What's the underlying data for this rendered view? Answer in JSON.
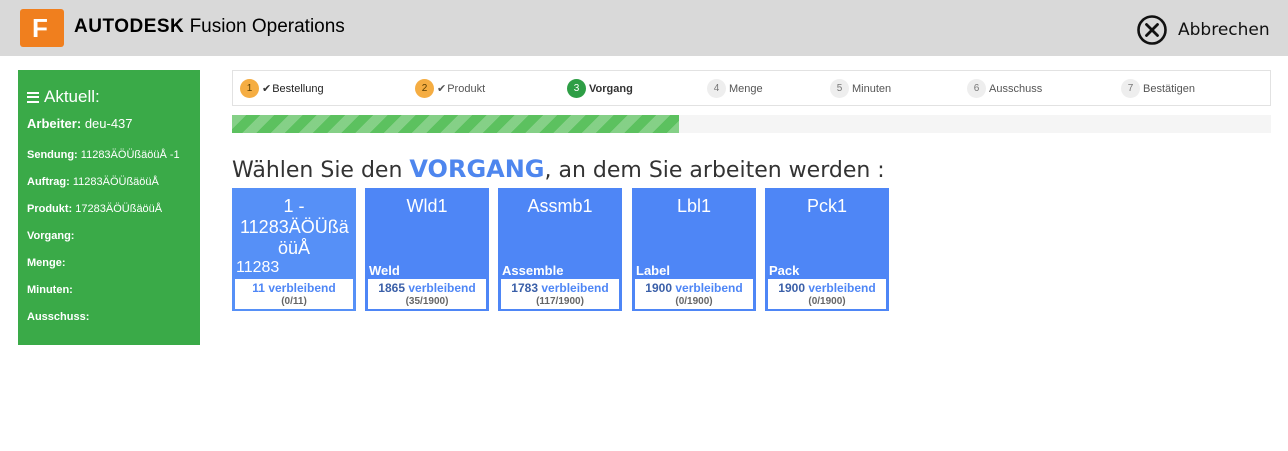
{
  "header": {
    "logo_letter": "F",
    "brand_bold": "AUTODESK",
    "brand_rest": "Fusion Operations",
    "cancel_label": "Abbrechen",
    "accent_color": "#f26f21"
  },
  "sidebar": {
    "title": "Aktuell:",
    "worker_label": "Arbeiter:",
    "worker_value": "deu-437",
    "rows": [
      {
        "label": "Sendung:",
        "value": "11283ÄÖÜßäöüÅ -1"
      },
      {
        "label": "Auftrag:",
        "value": "11283ÄÖÜßäöüÅ"
      },
      {
        "label": "Produkt:",
        "value": "17283ÄÖÜßäöüÅ"
      },
      {
        "label": "Vorgang:",
        "value": ""
      },
      {
        "label": "Menge:",
        "value": ""
      },
      {
        "label": "Minuten:",
        "value": ""
      },
      {
        "label": "Ausschuss:",
        "value": ""
      }
    ],
    "color": "#3aaa48"
  },
  "stepper": {
    "steps": [
      {
        "num": "1",
        "label": "Bestellung",
        "state": "done"
      },
      {
        "num": "2",
        "label": "Produkt",
        "state": "done"
      },
      {
        "num": "3",
        "label": "Vorgang",
        "state": "active"
      },
      {
        "num": "4",
        "label": "Menge",
        "state": "todo"
      },
      {
        "num": "5",
        "label": "Minuten",
        "state": "todo"
      },
      {
        "num": "6",
        "label": "Ausschuss",
        "state": "todo"
      },
      {
        "num": "7",
        "label": "Bestätigen",
        "state": "todo"
      }
    ],
    "check_glyph": "✔"
  },
  "progress": {
    "fraction": 0.43
  },
  "heading": {
    "before": "Wählen Sie den ",
    "emphasis": "VORGANG",
    "after": ", an dem Sie arbeiten werden :"
  },
  "operations": [
    {
      "name": "1 - 11283ÄÖÜßä öüÅ",
      "sub": "11283",
      "remaining": "11",
      "remaining_label": "verbleibend",
      "ratio": "(0/11)"
    },
    {
      "name": "Wld1",
      "sub": "Weld",
      "remaining": "1865",
      "remaining_label": "verbleibend",
      "ratio": "(35/1900)"
    },
    {
      "name": "Assmb1",
      "sub": "Assemble",
      "remaining": "1783",
      "remaining_label": "verbleibend",
      "ratio": "(117/1900)"
    },
    {
      "name": "Lbl1",
      "sub": "Label",
      "remaining": "1900",
      "remaining_label": "verbleibend",
      "ratio": "(0/1900)"
    },
    {
      "name": "Pck1",
      "sub": "Pack",
      "remaining": "1900",
      "remaining_label": "verbleibend",
      "ratio": "(0/1900)"
    }
  ]
}
